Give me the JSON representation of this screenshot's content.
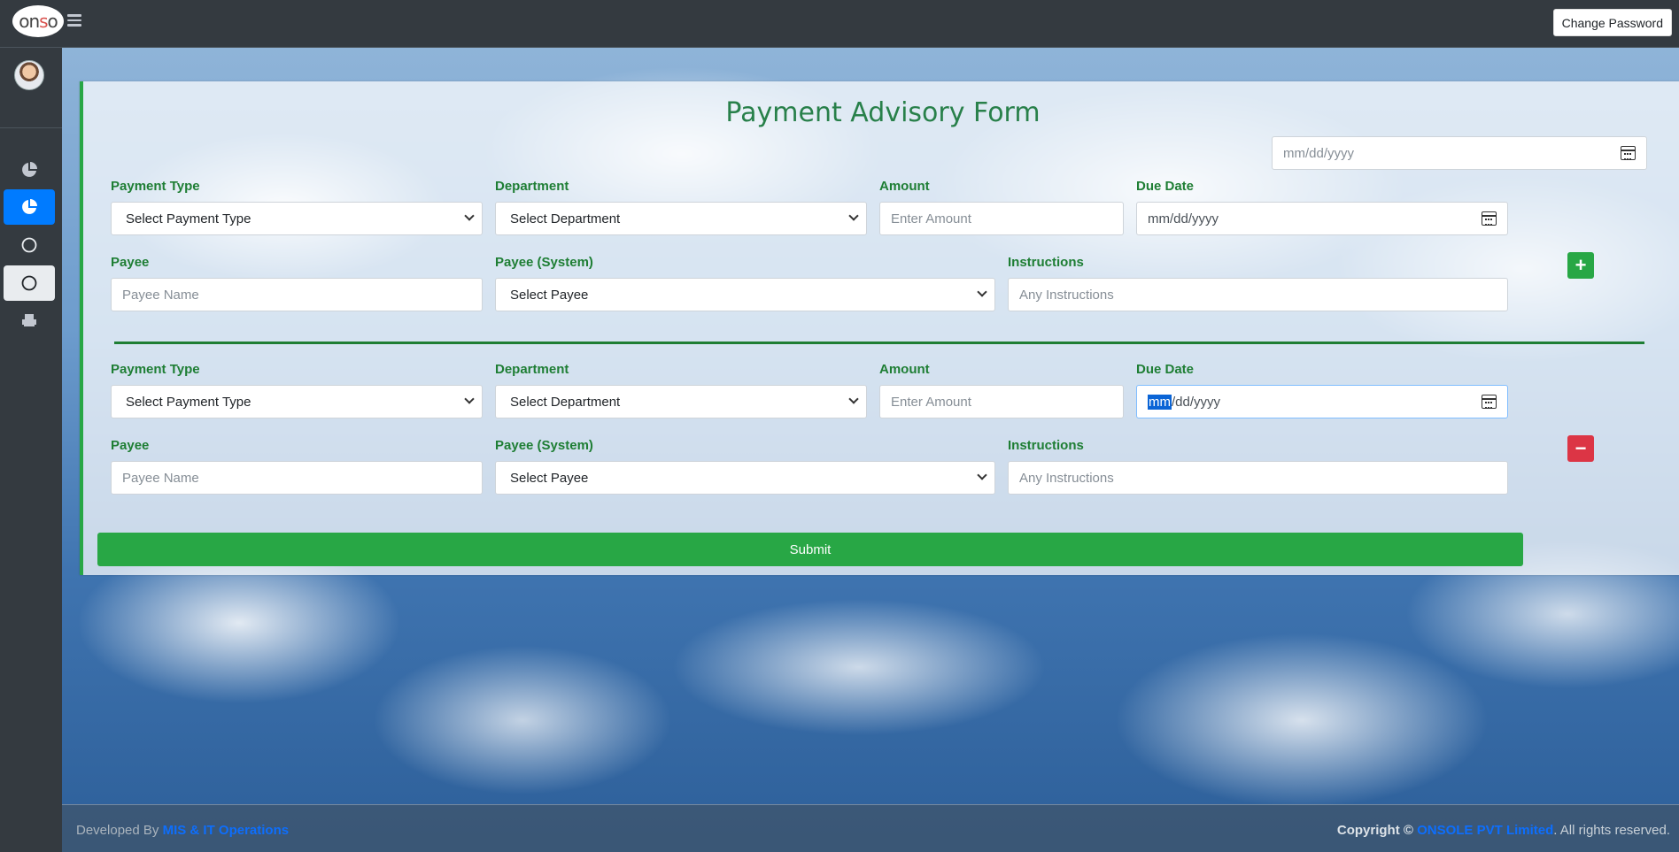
{
  "header": {
    "logo_text": "onsole",
    "change_password_label": "Change Password"
  },
  "sidebar": {
    "items": [
      {
        "icon": "pie-chart-icon"
      },
      {
        "icon": "pie-chart-icon",
        "active": true
      },
      {
        "icon": "circle-icon"
      },
      {
        "icon": "circle-icon"
      },
      {
        "icon": "printer-icon"
      }
    ]
  },
  "form": {
    "title": "Payment Advisory Form",
    "top_date": {
      "placeholder": "mm/dd/yyyy"
    },
    "labels": {
      "payment_type": "Payment Type",
      "department": "Department",
      "amount": "Amount",
      "due_date": "Due Date",
      "payee": "Payee",
      "payee_system": "Payee (System)",
      "instructions": "Instructions"
    },
    "placeholders": {
      "payment_type": "Select Payment Type",
      "department": "Select Department",
      "amount": "Enter Amount",
      "due_date": "mm/dd/yyyy",
      "payee": "Payee Name",
      "payee_system": "Select Payee",
      "instructions": "Any Instructions"
    },
    "due_date_focused": {
      "highlighted": "mm",
      "rest": "/dd/yyyy"
    },
    "add_symbol": "+",
    "remove_symbol": "−",
    "submit_label": "Submit"
  },
  "footer": {
    "developed_by": "Developed By",
    "developer_link": "MIS & IT Operations",
    "copyright": "Copyright ©",
    "company_link": "ONSOLE PVT Limited",
    "rights": ". All rights reserved."
  },
  "colors": {
    "accent_green": "#28a745",
    "label_green": "#1e7e34",
    "danger": "#dc3545",
    "primary": "#007bff",
    "dark": "#343a40"
  }
}
